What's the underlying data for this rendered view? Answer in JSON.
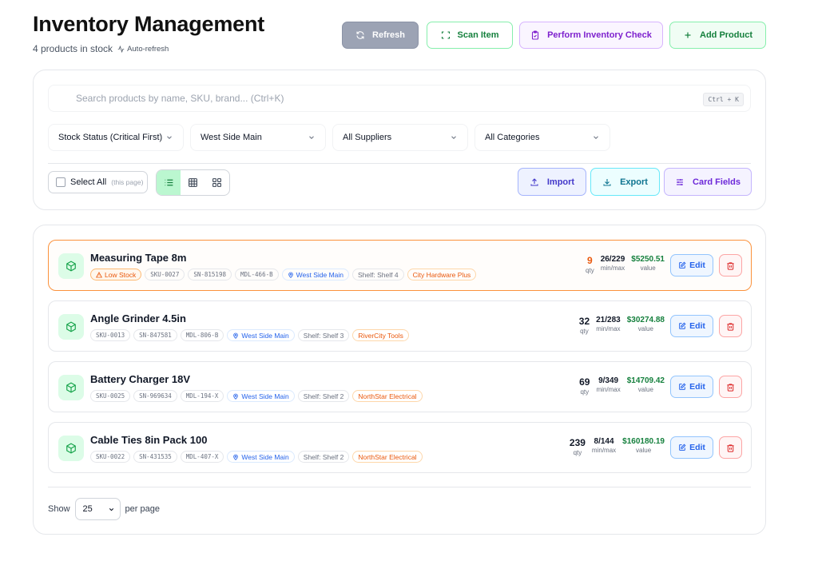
{
  "header": {
    "title": "Inventory Management",
    "subtitle": "4 products in stock",
    "auto_refresh": "Auto-refresh"
  },
  "actions": {
    "refresh": "Refresh",
    "scan": "Scan Item",
    "check": "Perform Inventory Check",
    "add": "Add Product"
  },
  "search": {
    "placeholder": "Search products by name, SKU, brand... (Ctrl+K)",
    "shortcut": "Ctrl + K"
  },
  "filters": {
    "stock_status": "Stock Status (Critical First)",
    "location": "West Side Main",
    "supplier": "All Suppliers",
    "category": "All Categories"
  },
  "toolbar": {
    "select_all": "Select All",
    "select_all_hint": "(this page)",
    "import": "Import",
    "export": "Export",
    "card_fields": "Card Fields"
  },
  "labels": {
    "qty": "qty",
    "minmax": "min/max",
    "value": "value",
    "edit": "Edit"
  },
  "products": [
    {
      "name": "Measuring Tape 8m",
      "status": "Low Stock",
      "sku": "SKU-0027",
      "serial": "SN-815198",
      "model": "MDL-466-B",
      "location": "West Side Main",
      "shelf": "Shelf: Shelf 4",
      "supplier": "City Hardware Plus",
      "qty": "9",
      "minmax": "26/229",
      "value": "$5250.51"
    },
    {
      "name": "Angle Grinder 4.5in",
      "sku": "SKU-0013",
      "serial": "SN-847581",
      "model": "MDL-806-B",
      "location": "West Side Main",
      "shelf": "Shelf: Shelf 3",
      "supplier": "RiverCity Tools",
      "qty": "32",
      "minmax": "21/283",
      "value": "$30274.88"
    },
    {
      "name": "Battery Charger 18V",
      "sku": "SKU-0025",
      "serial": "SN-969634",
      "model": "MDL-194-X",
      "location": "West Side Main",
      "shelf": "Shelf: Shelf 2",
      "supplier": "NorthStar Electrical",
      "qty": "69",
      "minmax": "9/349",
      "value": "$14709.42"
    },
    {
      "name": "Cable Ties 8in Pack 100",
      "sku": "SKU-0022",
      "serial": "SN-431535",
      "model": "MDL-407-X",
      "location": "West Side Main",
      "shelf": "Shelf: Shelf 2",
      "supplier": "NorthStar Electrical",
      "qty": "239",
      "minmax": "8/144",
      "value": "$160180.19"
    }
  ],
  "pagination": {
    "show": "Show",
    "per_page_value": "25",
    "per_page": "per page"
  }
}
